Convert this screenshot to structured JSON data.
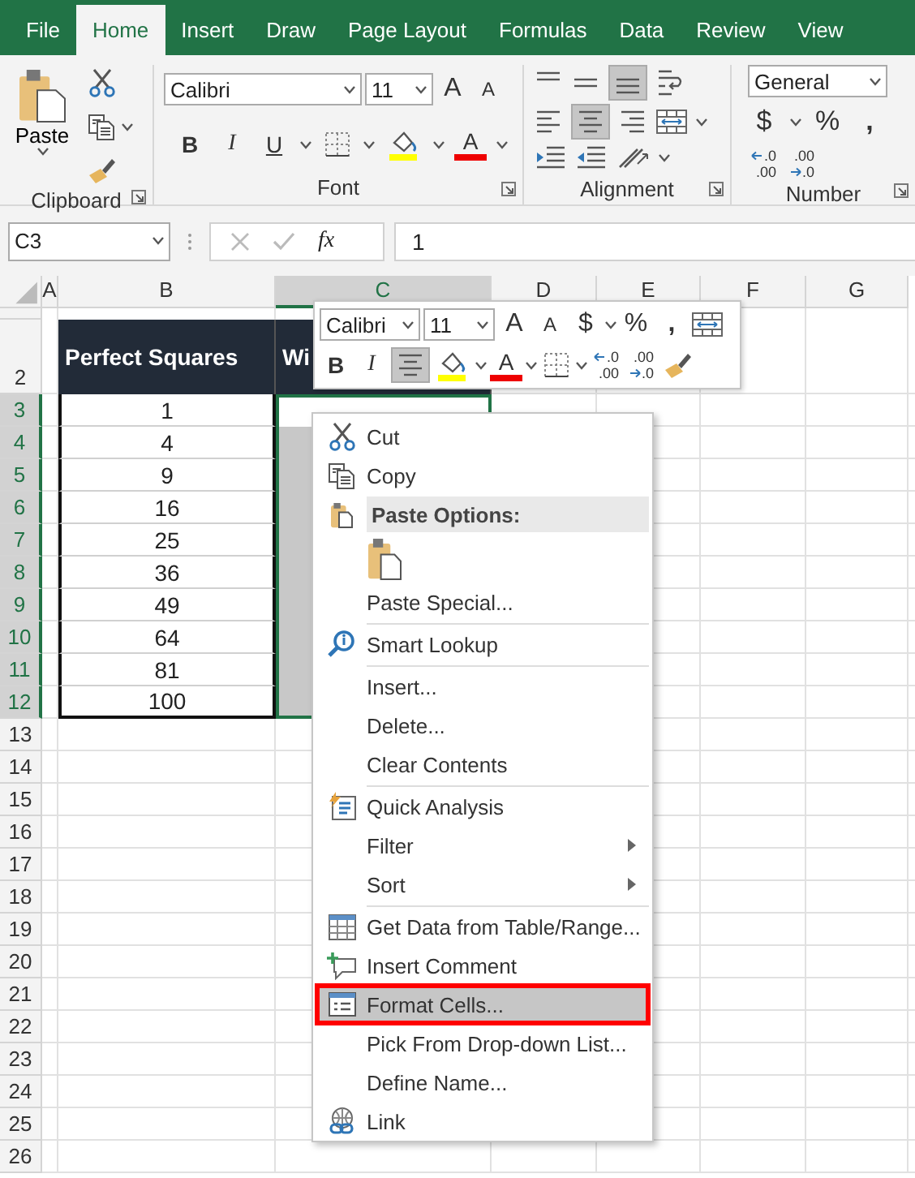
{
  "tabs": [
    {
      "label": "File",
      "selected": false
    },
    {
      "label": "Home",
      "selected": true
    },
    {
      "label": "Insert",
      "selected": false
    },
    {
      "label": "Draw",
      "selected": false
    },
    {
      "label": "Page Layout",
      "selected": false
    },
    {
      "label": "Formulas",
      "selected": false
    },
    {
      "label": "Data",
      "selected": false
    },
    {
      "label": "Review",
      "selected": false
    },
    {
      "label": "View",
      "selected": false
    }
  ],
  "ribbon": {
    "clipboard": {
      "paste": "Paste",
      "label": "Clipboard"
    },
    "font": {
      "name": "Calibri",
      "size": "11",
      "grow": "A",
      "shrink": "A",
      "bold": "B",
      "italic": "I",
      "underline": "U",
      "color_letter": "A",
      "label": "Font"
    },
    "alignment": {
      "label": "Alignment"
    },
    "number": {
      "format": "General",
      "currency": "$",
      "percent": "%",
      "comma": ",",
      "decimals": [
        {
          "kind": "increase",
          "top": ".0",
          "bottom": ".00"
        },
        {
          "kind": "decrease",
          "top": ".00",
          "bottom": ".0"
        }
      ],
      "label": "Number"
    }
  },
  "formula_bar": {
    "name_box": "C3",
    "fx": "fx",
    "value": "1"
  },
  "sheet": {
    "columns": [
      {
        "label": "A",
        "selected": false
      },
      {
        "label": "B",
        "selected": false
      },
      {
        "label": "C",
        "selected": true
      },
      {
        "label": "D",
        "selected": false
      },
      {
        "label": "E",
        "selected": false
      },
      {
        "label": "F",
        "selected": false
      },
      {
        "label": "G",
        "selected": false
      }
    ],
    "rows": [
      {
        "label": "2",
        "selected": false
      },
      {
        "label": "3",
        "selected": true
      },
      {
        "label": "4",
        "selected": true
      },
      {
        "label": "5",
        "selected": true
      },
      {
        "label": "6",
        "selected": true
      },
      {
        "label": "7",
        "selected": true
      },
      {
        "label": "8",
        "selected": true
      },
      {
        "label": "9",
        "selected": true
      },
      {
        "label": "10",
        "selected": true
      },
      {
        "label": "11",
        "selected": true
      },
      {
        "label": "12",
        "selected": true
      },
      {
        "label": "13",
        "selected": false
      },
      {
        "label": "14",
        "selected": false
      },
      {
        "label": "15",
        "selected": false
      },
      {
        "label": "16",
        "selected": false
      },
      {
        "label": "17",
        "selected": false
      },
      {
        "label": "18",
        "selected": false
      },
      {
        "label": "19",
        "selected": false
      },
      {
        "label": "20",
        "selected": false
      },
      {
        "label": "21",
        "selected": false
      },
      {
        "label": "22",
        "selected": false
      },
      {
        "label": "23",
        "selected": false
      },
      {
        "label": "24",
        "selected": false
      },
      {
        "label": "25",
        "selected": false
      },
      {
        "label": "26",
        "selected": false
      }
    ]
  },
  "table": {
    "headings": [
      "Perfect Squares",
      "Wi"
    ],
    "rows": [
      [
        "1"
      ],
      [
        "4"
      ],
      [
        "9"
      ],
      [
        "16"
      ],
      [
        "25"
      ],
      [
        "36"
      ],
      [
        "49"
      ],
      [
        "64"
      ],
      [
        "81"
      ],
      [
        "100"
      ]
    ]
  },
  "mini_toolbar": {
    "font": "Calibri",
    "size": "11",
    "grow": "A",
    "shrink": "A",
    "currency": "$",
    "percent": "%",
    "comma": ",",
    "bold": "B",
    "italic": "I",
    "center_selected": true,
    "color_letter": "A",
    "decimals": [
      {
        "kind": "increase",
        "top": ".0",
        "bottom": ".00"
      },
      {
        "kind": "decrease",
        "top": ".00",
        "bottom": ".0"
      }
    ]
  },
  "context_menu": [
    {
      "kind": "item",
      "label": "Cut",
      "submenu": false,
      "selected": false,
      "outlined": false
    },
    {
      "kind": "item",
      "label": "Copy",
      "submenu": false,
      "selected": false,
      "outlined": false
    },
    {
      "kind": "header",
      "label": "Paste Options:"
    },
    {
      "kind": "paste"
    },
    {
      "kind": "item",
      "label": "Paste Special...",
      "submenu": false,
      "selected": false,
      "outlined": false
    },
    {
      "kind": "separator"
    },
    {
      "kind": "item",
      "label": "Smart Lookup",
      "submenu": false,
      "selected": false,
      "outlined": false
    },
    {
      "kind": "separator"
    },
    {
      "kind": "item",
      "label": "Insert...",
      "submenu": false,
      "selected": false,
      "outlined": false
    },
    {
      "kind": "item",
      "label": "Delete...",
      "submenu": false,
      "selected": false,
      "outlined": false
    },
    {
      "kind": "item",
      "label": "Clear Contents",
      "submenu": false,
      "selected": false,
      "outlined": false
    },
    {
      "kind": "separator"
    },
    {
      "kind": "item",
      "label": "Quick Analysis",
      "submenu": false,
      "selected": false,
      "outlined": false
    },
    {
      "kind": "item",
      "label": "Filter",
      "submenu": true,
      "selected": false,
      "outlined": false
    },
    {
      "kind": "item",
      "label": "Sort",
      "submenu": true,
      "selected": false,
      "outlined": false
    },
    {
      "kind": "separator"
    },
    {
      "kind": "item",
      "label": "Get Data from Table/Range...",
      "submenu": false,
      "selected": false,
      "outlined": false
    },
    {
      "kind": "item",
      "label": "Insert Comment",
      "submenu": false,
      "selected": false,
      "outlined": false
    },
    {
      "kind": "item",
      "label": "Format Cells...",
      "submenu": false,
      "selected": true,
      "outlined": true
    },
    {
      "kind": "item",
      "label": "Pick From Drop-down List...",
      "submenu": false,
      "selected": false,
      "outlined": false
    },
    {
      "kind": "item",
      "label": "Define Name...",
      "submenu": false,
      "selected": false,
      "outlined": false
    },
    {
      "kind": "item",
      "label": "Link",
      "submenu": false,
      "selected": false,
      "outlined": false
    }
  ]
}
